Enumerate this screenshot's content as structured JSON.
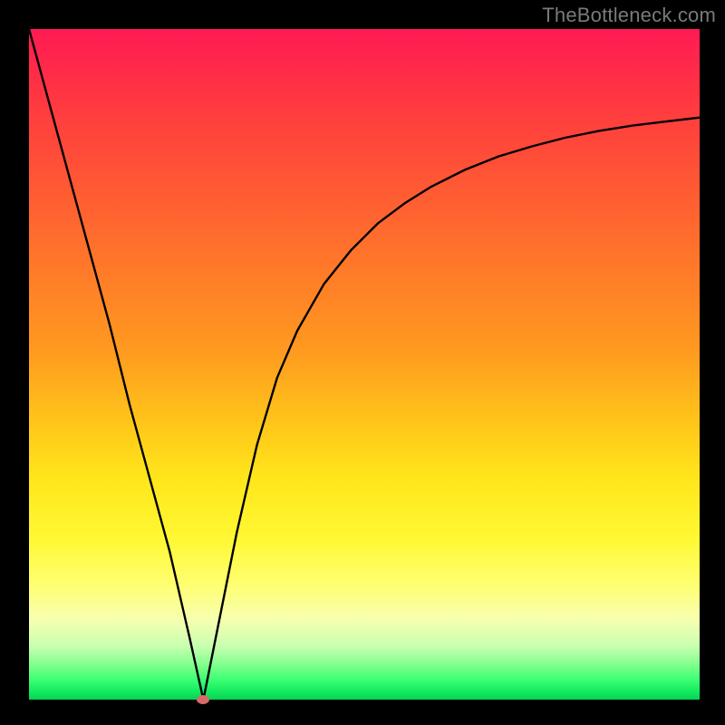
{
  "watermark": "TheBottleneck.com",
  "chart_data": {
    "type": "line",
    "title": "",
    "xlabel": "",
    "ylabel": "",
    "xlim": [
      0,
      100
    ],
    "ylim": [
      0,
      100
    ],
    "grid": false,
    "legend": false,
    "min_point": {
      "x": 26,
      "y": 0
    },
    "series": [
      {
        "name": "bottleneck-curve",
        "color": "#000000",
        "x": [
          0,
          3,
          6,
          9,
          12,
          15,
          18,
          21,
          24,
          26,
          28,
          31,
          34,
          37,
          40,
          44,
          48,
          52,
          56,
          60,
          65,
          70,
          75,
          80,
          85,
          90,
          95,
          100
        ],
        "y": [
          100,
          89,
          78,
          67,
          56,
          44,
          33,
          22,
          9,
          0,
          10,
          25,
          38,
          48,
          55,
          62,
          67,
          71,
          74,
          76.5,
          79,
          81,
          82.5,
          83.8,
          84.8,
          85.6,
          86.2,
          86.8
        ]
      }
    ],
    "annotations": [
      {
        "type": "marker",
        "x": 26,
        "y": 0,
        "color": "#d86a6a"
      }
    ]
  }
}
